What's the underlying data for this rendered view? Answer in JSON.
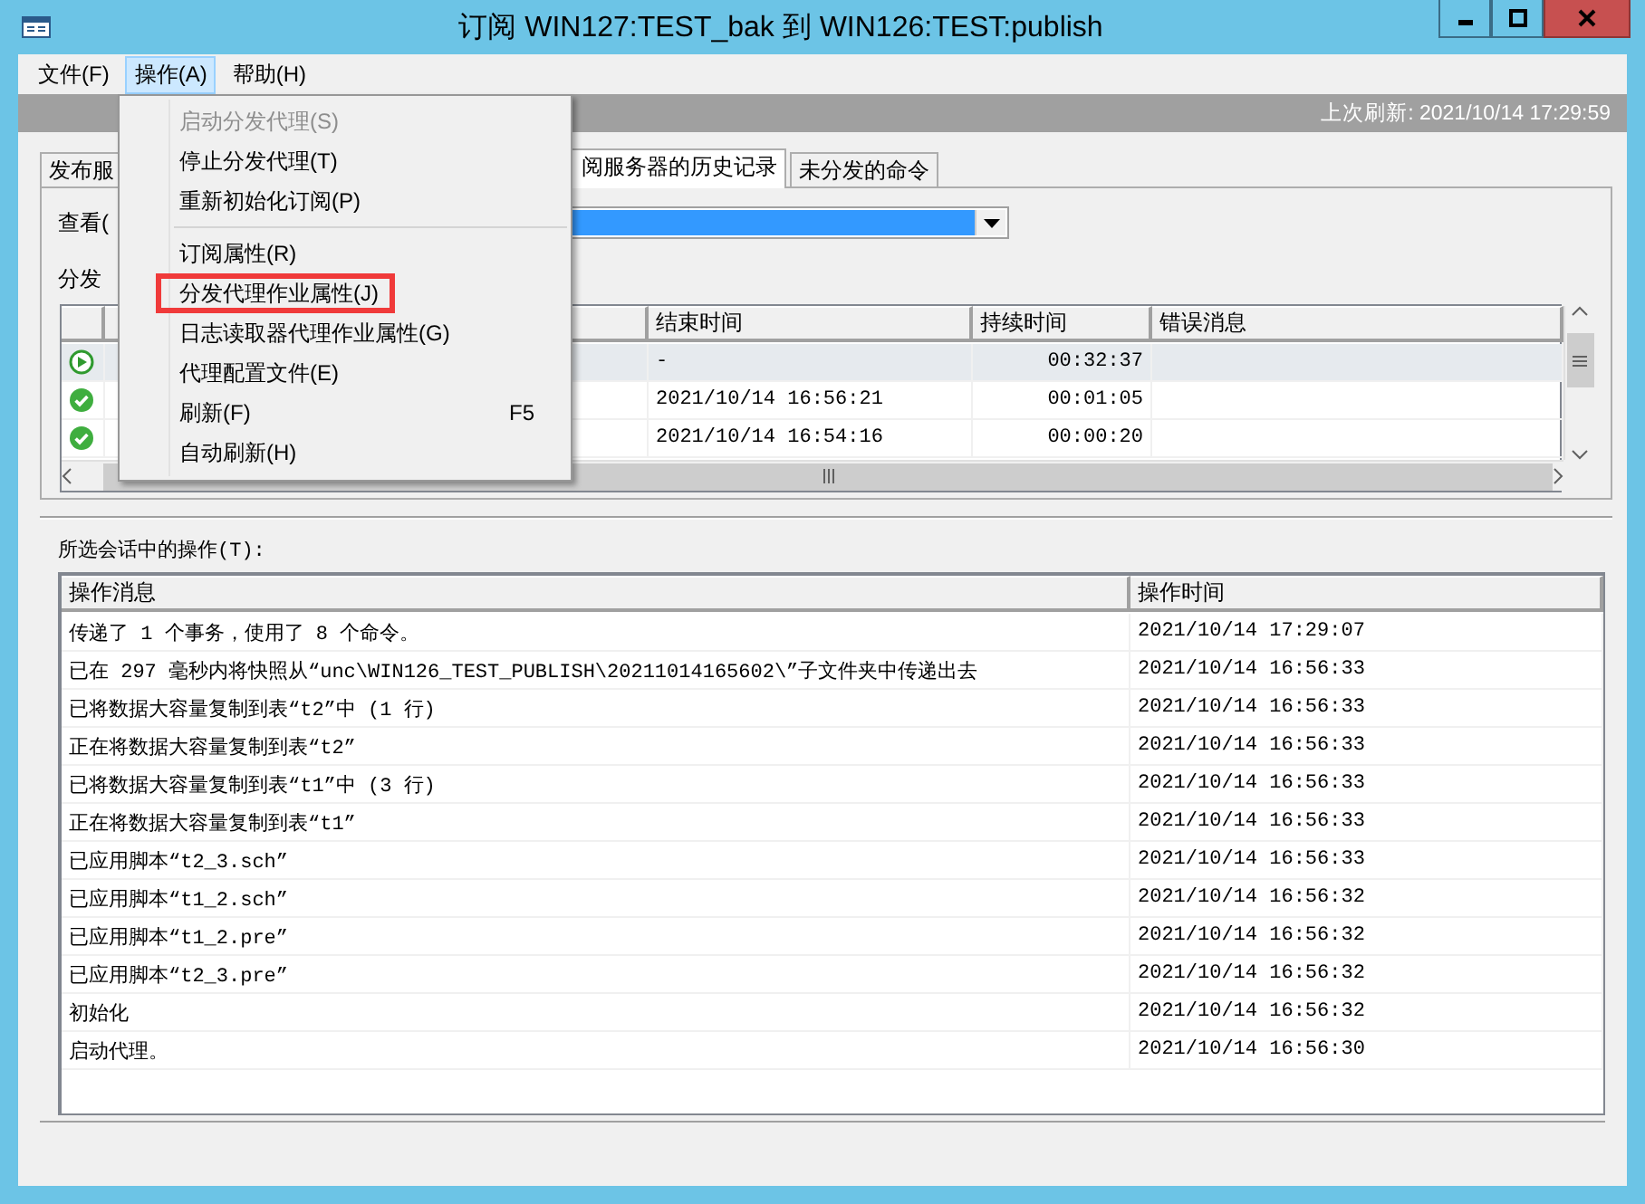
{
  "window": {
    "title": "订阅 WIN127:TEST_bak 到 WIN126:TEST:publish"
  },
  "menu_bar": [
    {
      "label": "文件(F)",
      "selected": false
    },
    {
      "label": "操作(A)",
      "selected": true
    },
    {
      "label": "帮助(H)",
      "selected": false
    }
  ],
  "last_refresh": "上次刷新: 2021/10/14 17:29:59",
  "tabs": [
    {
      "label": "发布服",
      "selected": false
    },
    {
      "label": "阅服务器的历史记录",
      "selected": true
    },
    {
      "label": "未分发的命令",
      "selected": false
    }
  ],
  "view_label": "查看(",
  "sessions_label": "分发",
  "sessions_table": {
    "columns": [
      "结束时间",
      "持续时间",
      "错误消息"
    ],
    "rows": [
      {
        "kind": "running",
        "selected": true,
        "end_time": "-",
        "duration": "00:32:37"
      },
      {
        "kind": "success",
        "selected": false,
        "end_time": "2021/10/14 16:56:21",
        "duration": "00:01:05"
      },
      {
        "kind": "success",
        "selected": false,
        "end_time": "2021/10/14 16:54:16",
        "duration": "00:00:20"
      }
    ]
  },
  "actions_label": "所选会话中的操作(T):",
  "actions_table": {
    "columns": [
      "操作消息",
      "操作时间"
    ],
    "rows": [
      [
        "传递了 1 个事务，使用了 8 个命令。",
        "2021/10/14 17:29:07"
      ],
      [
        "已在 297 毫秒内将快照从“unc\\WIN126_TEST_PUBLISH\\20211014165602\\”子文件夹中传递出去",
        "2021/10/14 16:56:33"
      ],
      [
        "已将数据大容量复制到表“t2”中 (1 行)",
        "2021/10/14 16:56:33"
      ],
      [
        "正在将数据大容量复制到表“t2”",
        "2021/10/14 16:56:33"
      ],
      [
        "已将数据大容量复制到表“t1”中 (3 行)",
        "2021/10/14 16:56:33"
      ],
      [
        "正在将数据大容量复制到表“t1”",
        "2021/10/14 16:56:33"
      ],
      [
        "已应用脚本“t2_3.sch”",
        "2021/10/14 16:56:33"
      ],
      [
        "已应用脚本“t1_2.sch”",
        "2021/10/14 16:56:32"
      ],
      [
        "已应用脚本“t1_2.pre”",
        "2021/10/14 16:56:32"
      ],
      [
        "已应用脚本“t2_3.pre”",
        "2021/10/14 16:56:32"
      ],
      [
        "初始化",
        "2021/10/14 16:56:32"
      ],
      [
        "启动代理。",
        "2021/10/14 16:56:30"
      ]
    ]
  },
  "context_menu": {
    "items": [
      {
        "kind": "item",
        "label": "启动分发代理(S)",
        "disabled": true,
        "highlighted": false
      },
      {
        "kind": "item",
        "label": "停止分发代理(T)",
        "disabled": false,
        "highlighted": false
      },
      {
        "kind": "item",
        "label": "重新初始化订阅(P)",
        "disabled": false,
        "highlighted": false
      },
      {
        "kind": "separator"
      },
      {
        "kind": "item",
        "label": "订阅属性(R)",
        "disabled": false,
        "highlighted": false
      },
      {
        "kind": "item",
        "label": "分发代理作业属性(J)",
        "disabled": false,
        "highlighted": true
      },
      {
        "kind": "item",
        "label": "日志读取器代理作业属性(G)",
        "disabled": false,
        "highlighted": false
      },
      {
        "kind": "item",
        "label": "代理配置文件(E)",
        "disabled": false,
        "highlighted": false
      },
      {
        "kind": "item",
        "label": "刷新(F)",
        "shortcut": "F5",
        "disabled": false,
        "highlighted": false
      },
      {
        "kind": "item",
        "label": "自动刷新(H)",
        "disabled": false,
        "highlighted": false
      }
    ]
  }
}
